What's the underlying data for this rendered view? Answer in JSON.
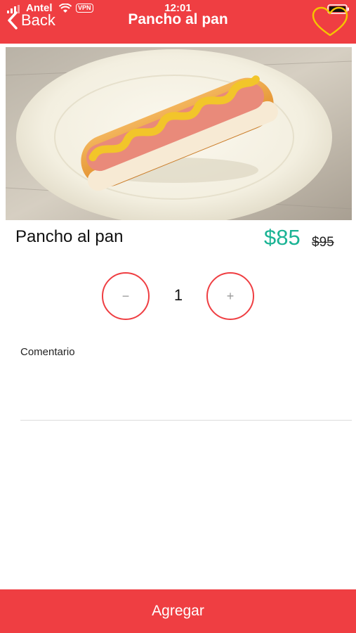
{
  "status_bar": {
    "carrier": "Antel",
    "vpn": "VPN",
    "time": "12:01",
    "icons": [
      "signal-icon",
      "wifi-icon",
      "battery-icon"
    ]
  },
  "header": {
    "back_label": "Back",
    "title": "Pancho al pan",
    "favorite_icon": "heart-outline-icon",
    "background": "#ef3e42",
    "favorite_color": "#f5c400"
  },
  "product": {
    "image": "hot-dog-on-plate",
    "name": "Pancho al pan",
    "price": "$85",
    "old_price": "$95",
    "price_color": "#1ab394"
  },
  "quantity": {
    "decrement_symbol": "−",
    "value": "1",
    "increment_symbol": "+"
  },
  "comment": {
    "label": "Comentario",
    "value": ""
  },
  "footer": {
    "add_label": "Agregar"
  }
}
